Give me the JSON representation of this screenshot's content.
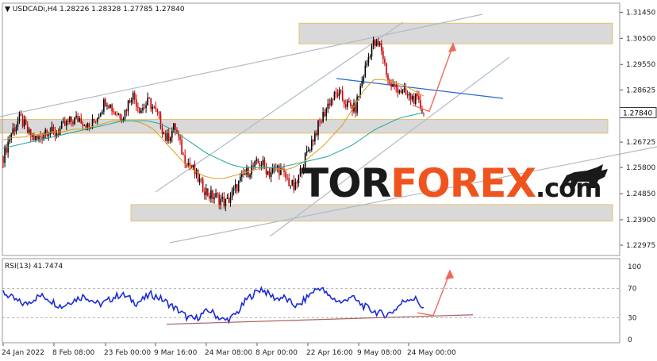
{
  "chart_data": [
    {
      "type": "line",
      "title": "USDCADi,H4  1.28226  1.28328  1.27785  1.27840",
      "symbol": "USDCADi,H4",
      "ohlc": {
        "open": 1.28226,
        "high": 1.28328,
        "low": 1.27785,
        "close": 1.2784
      },
      "ylim": [
        1.226,
        1.3178
      ],
      "y_ticks": [
        "1.31450",
        "1.30500",
        "1.29550",
        "1.28625",
        "1.27675",
        "1.26725",
        "1.25800",
        "1.24850",
        "1.23900",
        "1.22975"
      ],
      "current_price_label": "1.27840",
      "x_ticks": [
        "24 Jan 2022",
        "8 Feb 08:00",
        "23 Feb 00:00",
        "9 Mar 16:00",
        "24 Mar 08:00",
        "8 Apr 00:00",
        "22 Apr 16:00",
        "9 May 08:00",
        "24 May 00:00"
      ],
      "series": [
        {
          "values": [
            1.262,
            1.271,
            1.276,
            1.27,
            1.268,
            1.272,
            1.27,
            1.273,
            1.275,
            1.276,
            1.272,
            1.277,
            1.283,
            1.278,
            1.277,
            1.285,
            1.279,
            1.282,
            1.277,
            1.268,
            1.273,
            1.262,
            1.258,
            1.252,
            1.248,
            1.247,
            1.245,
            1.25,
            1.255,
            1.258,
            1.26,
            1.256,
            1.258,
            1.254,
            1.25,
            1.26,
            1.268,
            1.275,
            1.282,
            1.285,
            1.281,
            1.279,
            1.292,
            1.303,
            1.302,
            1.288,
            1.287,
            1.284,
            1.283,
            1.2784
          ]
        },
        {
          "values": [
            1.268,
            1.269,
            1.269,
            1.27,
            1.27,
            1.271,
            1.271,
            1.272,
            1.272,
            1.273,
            1.274,
            1.275,
            1.275,
            1.275,
            1.274,
            1.272,
            1.268,
            1.264,
            1.26,
            1.257,
            1.255,
            1.254,
            1.254,
            1.255,
            1.256,
            1.257,
            1.258,
            1.258,
            1.257,
            1.258,
            1.26,
            1.263,
            1.266,
            1.27,
            1.274,
            1.28,
            1.286,
            1.29,
            1.29,
            1.289,
            1.288,
            1.286,
            1.284
          ]
        },
        {
          "values": [
            1.265,
            1.266,
            1.267,
            1.268,
            1.269,
            1.27,
            1.271,
            1.272,
            1.273,
            1.274,
            1.275,
            1.275,
            1.275,
            1.274,
            1.272,
            1.269,
            1.266,
            1.263,
            1.261,
            1.259,
            1.258,
            1.258,
            1.258,
            1.258,
            1.259,
            1.26,
            1.261,
            1.262,
            1.264,
            1.266,
            1.269,
            1.272,
            1.274,
            1.276,
            1.277,
            1.278
          ]
        }
      ],
      "resistance_zone": [
        1.303,
        1.3105
      ],
      "middle_zone": [
        1.2705,
        1.2755
      ],
      "support_zone": [
        1.2385,
        1.2445
      ],
      "forecast_target": 1.3025,
      "colors": {
        "candle_up": "#000000",
        "candle_down": "#cc0000",
        "ma_fast": "#d8a020",
        "ma_slow": "#1aa99a",
        "channel": "#aebcc8",
        "trend_blue": "#2a66d0",
        "arrow": "#f06a5a",
        "zone_fill": "#d9d9d9",
        "zone_edge": "#e8c070"
      }
    },
    {
      "type": "line",
      "title": "RSI(13) 41.7474",
      "ylim": [
        0,
        100
      ],
      "y_ticks": [
        "100",
        "70",
        "30",
        "0"
      ],
      "levels": [
        30,
        70
      ],
      "series": [
        {
          "values": [
            65,
            58,
            52,
            48,
            55,
            60,
            57,
            50,
            45,
            52,
            56,
            60,
            54,
            48,
            52,
            58,
            62,
            57,
            50,
            55,
            62,
            58,
            52,
            45,
            38,
            30,
            28,
            35,
            40,
            32,
            26,
            30,
            40,
            55,
            63,
            70,
            62,
            56,
            58,
            50,
            45,
            56,
            66,
            72,
            60,
            55,
            50,
            60,
            52,
            45,
            40,
            36,
            34,
            40,
            50,
            57,
            55,
            42
          ]
        }
      ],
      "trendline": [
        [
          0.04,
          21
        ],
        [
          0.92,
          34
        ]
      ],
      "forecast_target": 92,
      "colors": {
        "rsi": "#1a2ad8",
        "trendline": "#a86060",
        "arrow": "#f06a5a"
      }
    }
  ],
  "watermark": {
    "part1": "TOR",
    "part2": "FOREX",
    "part3": ".com"
  }
}
